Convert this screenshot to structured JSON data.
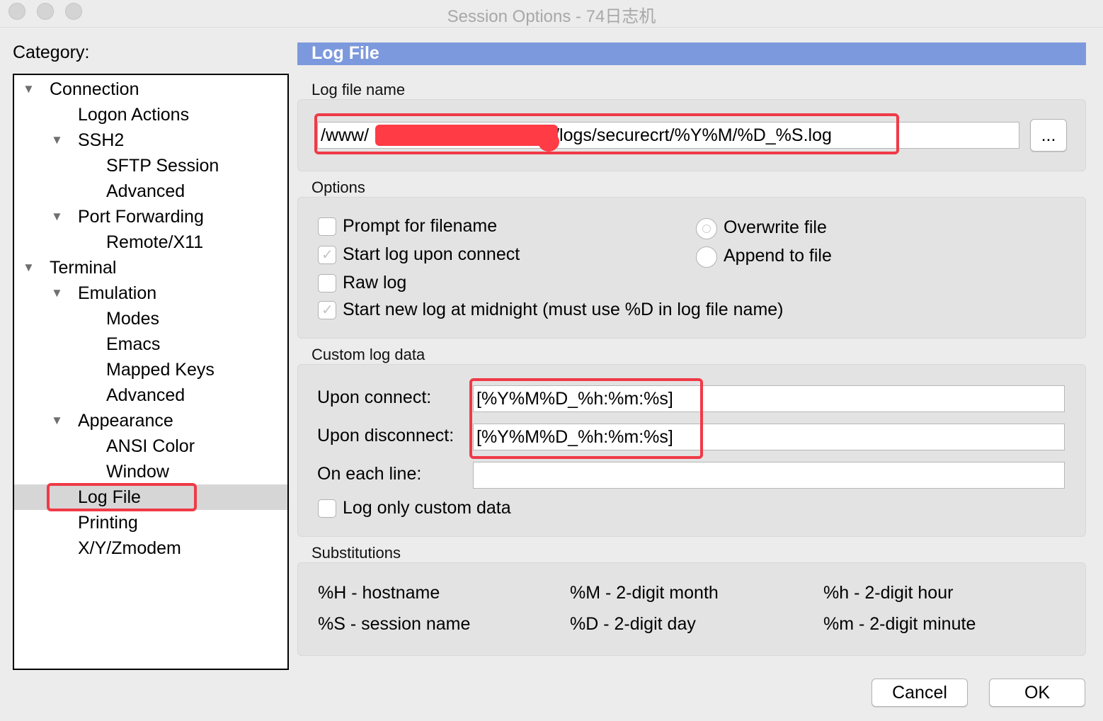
{
  "window": {
    "title": "Session Options - 74日志机"
  },
  "category": {
    "label": "Category:",
    "items": [
      {
        "label": "Connection",
        "expanded": true
      },
      {
        "label": "Logon Actions"
      },
      {
        "label": "SSH2",
        "expanded": true
      },
      {
        "label": "SFTP Session"
      },
      {
        "label": "Advanced"
      },
      {
        "label": "Port Forwarding",
        "expanded": true
      },
      {
        "label": "Remote/X11"
      },
      {
        "label": "Terminal",
        "expanded": true
      },
      {
        "label": "Emulation",
        "expanded": true
      },
      {
        "label": "Modes"
      },
      {
        "label": "Emacs"
      },
      {
        "label": "Mapped Keys"
      },
      {
        "label": "Advanced"
      },
      {
        "label": "Appearance",
        "expanded": true
      },
      {
        "label": "ANSI Color"
      },
      {
        "label": "Window"
      },
      {
        "label": "Log File",
        "selected": true
      },
      {
        "label": "Printing"
      },
      {
        "label": "X/Y/Zmodem"
      }
    ]
  },
  "panel": {
    "title": "Log File",
    "log_file_name": {
      "label": "Log file name",
      "value_prefix": "/www/",
      "value_suffix": "/logs/securecrt/%Y%M/%D_%S.log",
      "browse_label": "..."
    },
    "options": {
      "label": "Options",
      "checkboxes": [
        {
          "label": "Prompt for filename",
          "checked": false
        },
        {
          "label": "Start log upon connect",
          "checked": true
        },
        {
          "label": "Raw log",
          "checked": false
        },
        {
          "label": "Start new log at midnight (must use %D in log file name)",
          "checked": true
        }
      ],
      "radios": [
        {
          "label": "Overwrite file",
          "selected": true
        },
        {
          "label": "Append to file",
          "selected": false
        }
      ]
    },
    "custom_log_data": {
      "label": "Custom log data",
      "upon_connect_label": "Upon connect:",
      "upon_connect_value": "[%Y%M%D_%h:%m:%s]",
      "upon_disconnect_label": "Upon disconnect:",
      "upon_disconnect_value": "[%Y%M%D_%h:%m:%s]",
      "on_each_line_label": "On each line:",
      "on_each_line_value": "",
      "log_only_custom_label": "Log only custom data"
    },
    "substitutions": {
      "label": "Substitutions",
      "items": [
        "%H - hostname",
        "%M - 2-digit month",
        "%h - 2-digit hour",
        "%S - session name",
        "%D - 2-digit day",
        "%m - 2-digit minute"
      ]
    }
  },
  "buttons": {
    "cancel": "Cancel",
    "ok": "OK"
  },
  "colors": {
    "section_header": "#7d99dd",
    "annotation_red": "#f03a47",
    "selected_row": "#d6d6d6"
  }
}
